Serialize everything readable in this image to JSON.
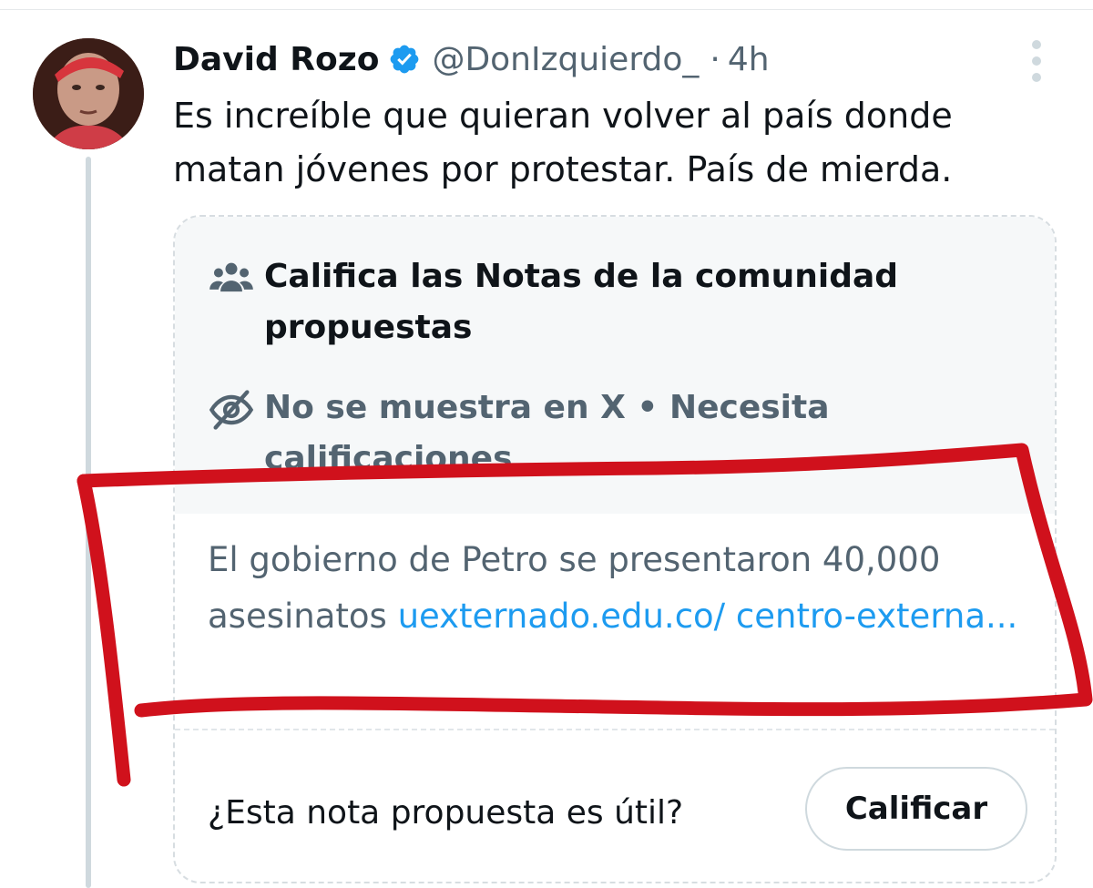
{
  "tweet": {
    "author_name": "David Rozo",
    "handle": "@DonIzquierdo_",
    "separator": "·",
    "time": "4h",
    "text": "Es increíble que quieran volver al país donde matan jóvenes por protestar. País de mierda."
  },
  "community_note": {
    "prompt_title": "Califica las Notas de la comunidad propuestas",
    "status": "No se muestra en X • Necesita calificaciones",
    "note_text": "El gobierno de Petro se presentaron 40,000 asesinatos ",
    "note_link": "uexternado.edu.co/ centro-externa...",
    "question": "¿Esta nota propuesta es útil?",
    "rate_button": "Calificar"
  },
  "colors": {
    "verified": "#1d9bf0",
    "link": "#1d9bf0",
    "annotation": "#d0111c"
  },
  "icons": {
    "verified": "verified-badge-icon",
    "more": "more-options-icon",
    "community": "community-icon",
    "hidden": "eye-slash-icon"
  }
}
